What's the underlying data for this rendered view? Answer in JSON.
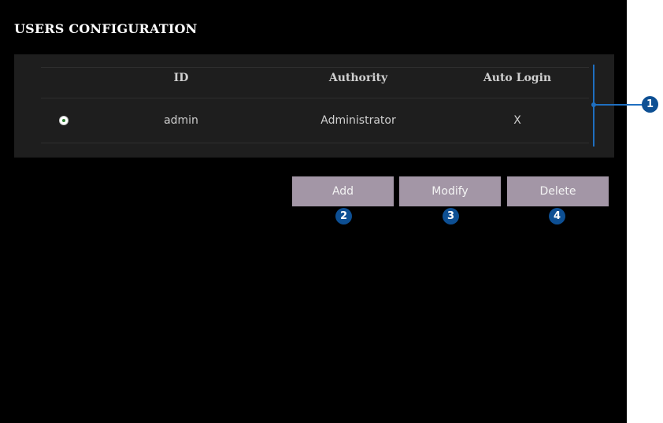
{
  "page": {
    "title": "USERS CONFIGURATION"
  },
  "users_table": {
    "columns": [
      "ID",
      "Authority",
      "Auto Login"
    ],
    "rows": [
      {
        "selected": true,
        "id": "admin",
        "authority": "Administrator",
        "auto_login": "X"
      }
    ]
  },
  "actions": {
    "add_label": "Add",
    "modify_label": "Modify",
    "delete_label": "Delete"
  },
  "callouts": [
    "1",
    "2",
    "3",
    "4"
  ],
  "colors": {
    "background": "#000000",
    "table_background": "#1e1e1e",
    "button": "#a396a6",
    "callout": "#0d4f93",
    "bracket": "#1f6fc0"
  }
}
